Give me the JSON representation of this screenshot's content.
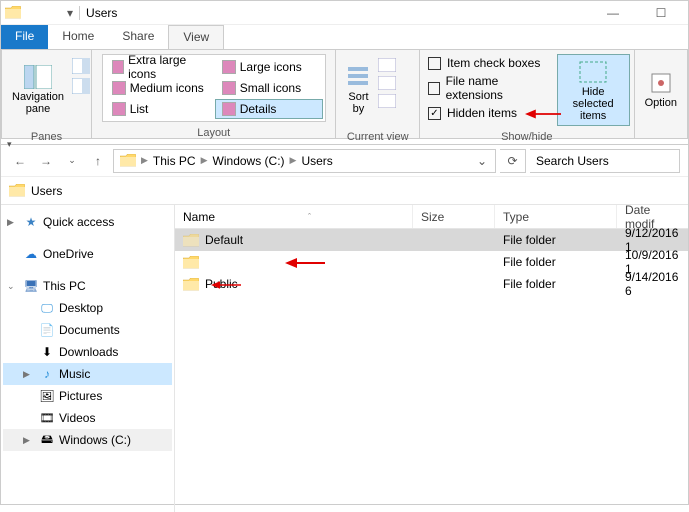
{
  "window": {
    "title": "Users"
  },
  "tabs": {
    "file": "File",
    "home": "Home",
    "share": "Share",
    "view": "View"
  },
  "ribbon": {
    "panes": {
      "navpane": "Navigation\npane",
      "label": "Panes"
    },
    "layout": {
      "opts": [
        "Extra large icons",
        "Large icons",
        "Medium icons",
        "Small icons",
        "List",
        "Details"
      ],
      "label": "Layout"
    },
    "current": {
      "sortby": "Sort\nby",
      "label": "Current view"
    },
    "showhide": {
      "itemcheck": "Item check boxes",
      "fileext": "File name extensions",
      "hidden": "Hidden items",
      "hidesel": "Hide selected\nitems",
      "label": "Show/hide"
    },
    "options": "Option"
  },
  "breadcrumb": {
    "seg1": "This PC",
    "seg2": "Windows (C:)",
    "seg3": "Users"
  },
  "search": {
    "placeholder": "Search Users"
  },
  "locbar": {
    "label": "Users"
  },
  "tree": {
    "quick": "Quick access",
    "onedrive": "OneDrive",
    "thispc": "This PC",
    "desktop": "Desktop",
    "documents": "Documents",
    "downloads": "Downloads",
    "music": "Music",
    "pictures": "Pictures",
    "videos": "Videos",
    "cdrive": "Windows (C:)"
  },
  "columns": {
    "name": "Name",
    "size": "Size",
    "type": "Type",
    "date": "Date modif"
  },
  "rows": [
    {
      "name": "Default",
      "size": "",
      "type": "File folder",
      "date": "9/12/2016 1"
    },
    {
      "name": "",
      "size": "",
      "type": "File folder",
      "date": "10/9/2016 1"
    },
    {
      "name": "Public",
      "size": "",
      "type": "File folder",
      "date": "9/14/2016 6"
    }
  ]
}
